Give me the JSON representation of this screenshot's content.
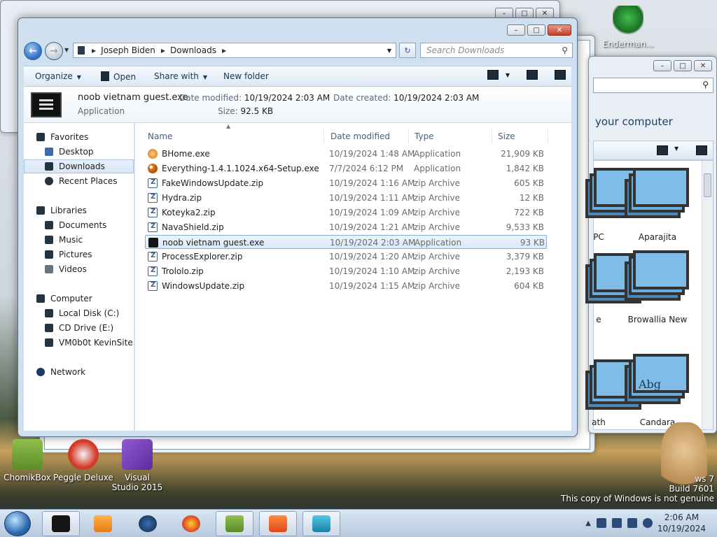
{
  "explorer": {
    "breadcrumb": [
      "Joseph Biden",
      "Downloads"
    ],
    "search_placeholder": "Search Downloads",
    "toolbar": {
      "organize": "Organize",
      "open": "Open",
      "share_with": "Share with",
      "new_folder": "New folder"
    },
    "details": {
      "name": "noob vietnam guest.exe",
      "type": "Application",
      "date_modified_label": "Date modified:",
      "date_modified": "10/19/2024 2:03 AM",
      "size_label": "Size:",
      "size": "92.5 KB",
      "date_created_label": "Date created:",
      "date_created": "10/19/2024 2:03 AM"
    },
    "nav": {
      "favorites": "Favorites",
      "desktop": "Desktop",
      "downloads": "Downloads",
      "recent_places": "Recent Places",
      "libraries": "Libraries",
      "documents": "Documents",
      "music": "Music",
      "pictures": "Pictures",
      "videos": "Videos",
      "computer": "Computer",
      "local_disk": "Local Disk (C:)",
      "cd_drive": "CD Drive (E:)",
      "vm": "VM0b0t KevinSite",
      "network": "Network"
    },
    "columns": {
      "name": "Name",
      "date_modified": "Date modified",
      "type": "Type",
      "size": "Size"
    },
    "files": [
      {
        "name": "BHome.exe",
        "date": "10/19/2024 1:48 AM",
        "type": "Application",
        "size": "21,909 KB",
        "icon": "bh"
      },
      {
        "name": "Everything-1.4.1.1024.x64-Setup.exe",
        "date": "7/7/2024 6:12 PM",
        "type": "Application",
        "size": "1,842 KB",
        "icon": "ev"
      },
      {
        "name": "FakeWindowsUpdate.zip",
        "date": "10/19/2024 1:16 AM",
        "type": "zip Archive",
        "size": "605 KB",
        "icon": "zip"
      },
      {
        "name": "Hydra.zip",
        "date": "10/19/2024 1:11 AM",
        "type": "zip Archive",
        "size": "12 KB",
        "icon": "zip"
      },
      {
        "name": "Koteyka2.zip",
        "date": "10/19/2024 1:09 AM",
        "type": "zip Archive",
        "size": "722 KB",
        "icon": "zip"
      },
      {
        "name": "NavaShield.zip",
        "date": "10/19/2024 1:21 AM",
        "type": "zip Archive",
        "size": "9,533 KB",
        "icon": "zip"
      },
      {
        "name": "noob vietnam guest.exe",
        "date": "10/19/2024 2:03 AM",
        "type": "Application",
        "size": "93 KB",
        "icon": "app"
      },
      {
        "name": "ProcessExplorer.zip",
        "date": "10/19/2024 1:20 AM",
        "type": "zip Archive",
        "size": "3,379 KB",
        "icon": "zip"
      },
      {
        "name": "Trololo.zip",
        "date": "10/19/2024 1:10 AM",
        "type": "zip Archive",
        "size": "2,193 KB",
        "icon": "zip"
      },
      {
        "name": "WindowsUpdate.zip",
        "date": "10/19/2024 1:15 AM",
        "type": "zip Archive",
        "size": "604 KB",
        "icon": "zip"
      }
    ]
  },
  "font_window": {
    "heading_fragment": "your computer",
    "fonts": [
      {
        "label": "PC"
      },
      {
        "label": "Aparajita"
      },
      {
        "label": "e"
      },
      {
        "label": "Browallia New"
      },
      {
        "label": "ath"
      },
      {
        "label": "Candara",
        "sample": "Abg"
      }
    ]
  },
  "desktop": {
    "icons": [
      {
        "label": "Enderman..."
      },
      {
        "label": "ChomikBox"
      },
      {
        "label": "Peggle Deluxe"
      },
      {
        "label": "Visual Studio 2015"
      }
    ],
    "watermark_line1": "ws 7",
    "watermark_line2": "Build 7601",
    "watermark_line3": "This copy of Windows is not genuine"
  },
  "taskbar": {
    "time": "2:06 AM",
    "date": "10/19/2024"
  }
}
